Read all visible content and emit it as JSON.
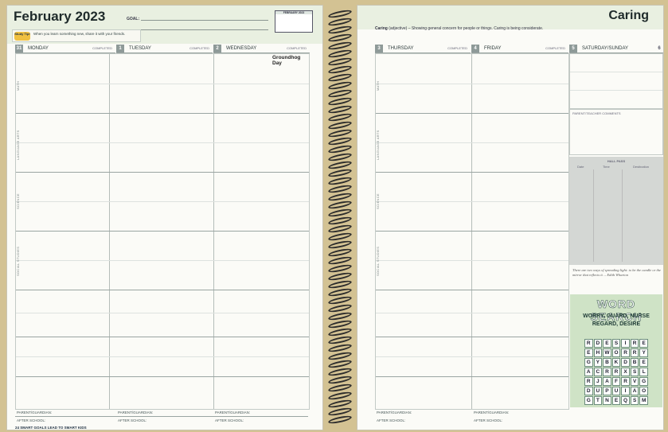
{
  "left_page": {
    "title": "February 2023",
    "goal_label": "GOAL:",
    "study_tip_icon": "Study Tip!",
    "study_tip_text": "When you learn something new, share it with your friends.",
    "mini_calendar_title": "FEBRUARY 2023",
    "days": [
      {
        "num": "31",
        "name": "MONDAY",
        "note": ""
      },
      {
        "num": "1",
        "name": "TUESDAY",
        "note": ""
      },
      {
        "num": "2",
        "name": "WEDNESDAY",
        "note": "Groundhog Day"
      }
    ],
    "completed_label": "COMPLETED",
    "subjects": [
      "MATH",
      "LANGUAGE ARTS",
      "SCIENCE",
      "SOCIAL STUDIES"
    ],
    "parent_guardian_label": "PARENT/GUARDIAN:",
    "after_school_label": "AFTER SCHOOL:",
    "footer_text": "24 SMART GOALS LEAD TO SMART KIDS"
  },
  "right_page": {
    "title": "Caring",
    "definition_word": "Caring",
    "definition_text": "(adjective) – Showing general concern for people or things. Caring is being considerate.",
    "days": [
      {
        "num": "3",
        "name": "THURSDAY"
      },
      {
        "num": "4",
        "name": "FRIDAY"
      },
      {
        "num": "5",
        "name": "SATURDAY/SUNDAY",
        "num2": "6"
      }
    ],
    "completed_label": "COMPLETED",
    "subjects": [
      "MATH",
      "LANGUAGE ARTS",
      "SCIENCE",
      "SOCIAL STUDIES"
    ],
    "parent_teacher_label": "PARENT/TEACHER COMMENTS",
    "hall_pass_label": "HALL PASS",
    "hall_pass_cols": [
      "Date",
      "Time",
      "Destination"
    ],
    "quote": "There are two ways of spreading light: to be the candle or the mirror that reflects it. – Edith Wharton",
    "word_search_title": "WORD SEARCH",
    "word_search_words_line1": "WORRY, GUARD, NURSE",
    "word_search_words_line2": "REGARD, DESIRE",
    "word_search_grid": [
      [
        "R",
        "D",
        "E",
        "S",
        "I",
        "R",
        "E"
      ],
      [
        "E",
        "H",
        "W",
        "O",
        "R",
        "R",
        "Y"
      ],
      [
        "G",
        "Y",
        "B",
        "K",
        "D",
        "B",
        "E"
      ],
      [
        "A",
        "C",
        "R",
        "R",
        "X",
        "S",
        "L"
      ],
      [
        "R",
        "J",
        "A",
        "F",
        "R",
        "V",
        "G"
      ],
      [
        "D",
        "U",
        "P",
        "U",
        "I",
        "A",
        "O"
      ],
      [
        "G",
        "T",
        "N",
        "E",
        "Q",
        "S",
        "M"
      ]
    ],
    "parent_guardian_label": "PARENT/GUARDIAN:",
    "after_school_label": "AFTER SCHOOL:"
  },
  "colors": {
    "header_tint": "#e9f0e1",
    "day_number": "#8e9a98",
    "word_search_bg": "#cfe3c6",
    "background": "#d3c293"
  }
}
